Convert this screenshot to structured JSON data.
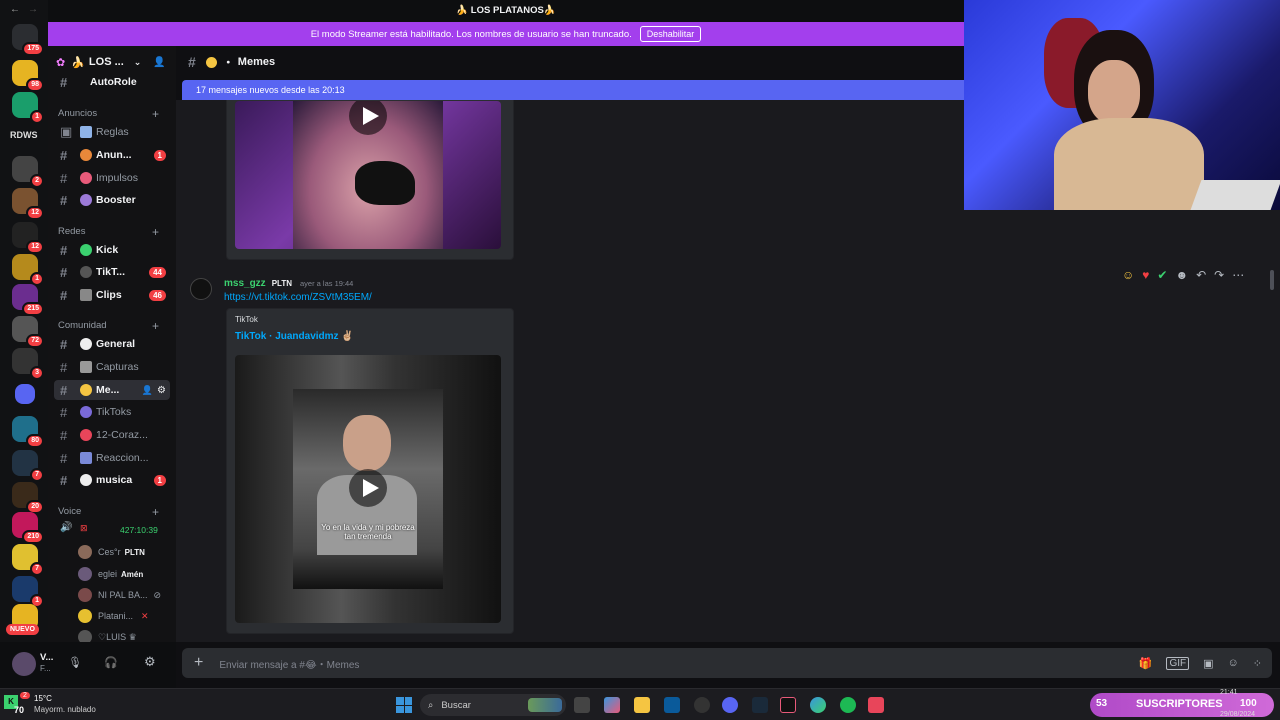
{
  "window_title": "🍌 LOS PLATANOS🍌",
  "streamer_bar": {
    "text": "El modo Streamer está habilitado. Los nombres de usuario se han truncado.",
    "button": "Deshabilitar"
  },
  "servers": [
    {
      "badge": "175"
    },
    {
      "badge": "98"
    },
    {
      "badge": "1"
    },
    {
      "label": "RDWS"
    },
    {
      "badge": "2"
    },
    {
      "badge": "12"
    },
    {
      "badge": "12"
    },
    {
      "badge": "1"
    },
    {
      "badge": "215"
    },
    {
      "badge": "72"
    },
    {
      "badge": "3"
    },
    {
      "badge": ""
    },
    {
      "badge": "80"
    },
    {
      "badge": "7"
    },
    {
      "badge": "20"
    },
    {
      "badge": "210"
    },
    {
      "badge": "7"
    },
    {
      "badge": "1"
    },
    {
      "badge": ""
    }
  ],
  "new_label": "NUEVO",
  "sidebar": {
    "server_name": "LOS ...",
    "categories": {
      "anuncios": "Anuncios",
      "redes": "Redes",
      "comunidad": "Comunidad",
      "voice": "Voice"
    },
    "channels": {
      "autorole": "AutoRole",
      "reglas": "Reglas",
      "anun": "Anun...",
      "anun_count": "1",
      "impulsos": "Impulsos",
      "booster": "Booster",
      "kick": "Kick",
      "tiktok": "TikT...",
      "tiktok_count": "44",
      "clips": "Clips",
      "clips_count": "46",
      "general": "General",
      "capturas": "Capturas",
      "memes": "Me...",
      "tiktoks": "TikToks",
      "corazon": "12-Coraz...",
      "reacciones": "Reaccion...",
      "musica": "musica",
      "musica_count": "1"
    },
    "voice_time": "427:10:39",
    "voice_users": [
      {
        "name": "Ces°r",
        "tag": "PLTN"
      },
      {
        "name": "eglei",
        "tag": "Amén"
      },
      {
        "name": "NI PAL BA...",
        "tag": ""
      },
      {
        "name": "Platani...",
        "tag": ""
      },
      {
        "name": "♡LUIS ♛",
        "tag": ""
      }
    ]
  },
  "user_panel": {
    "name": "V...",
    "sub": "F..."
  },
  "channel_header": {
    "name": "Memes"
  },
  "new_messages": "17 mensajes nuevos desde las 20:13",
  "message": {
    "author": "mss_gzz",
    "tag": "PLTN",
    "time": "ayer a las 19:44",
    "link": "https://vt.tiktok.com/ZSVtM35EM/",
    "embed": {
      "provider": "TikTok",
      "title": "TikTok · Juandavidmz ✌🏼",
      "caption_line1": "Yo en la vida y mi pobreza",
      "caption_line2": "tan tremenda"
    }
  },
  "input_placeholder": "Enviar mensaje a #😂・Memes",
  "taskbar": {
    "weather_temp": "15°C",
    "weather_desc": "Mayorm. nublado",
    "weather_badge": "2",
    "level": "70",
    "search": "Buscar",
    "time": "21:41",
    "date": "29/08/2024"
  },
  "overlay": {
    "count": "53",
    "label": "SUSCRIPTORES",
    "goal": "100"
  },
  "colors": {
    "accent": "#a33fed",
    "blurple": "#5865f2",
    "red": "#f23f43"
  }
}
